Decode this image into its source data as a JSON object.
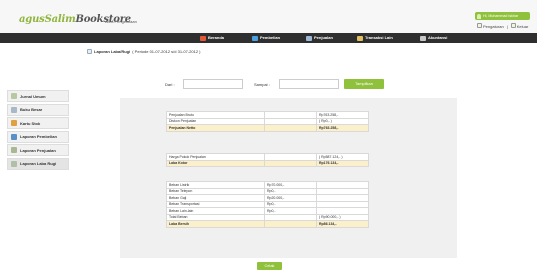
{
  "header": {
    "logo_main": "agusSalim",
    "logo_store": "Bookstore",
    "logo_sub": "Area Pengelolaan",
    "user": "Hi, Muhammad Iskhar",
    "settings_label": "Pengaturan",
    "separator": "|",
    "logout_label": "Keluar"
  },
  "nav": {
    "items": [
      {
        "label": "Beranda",
        "icon": "home-icon",
        "color": "#e05a3a"
      },
      {
        "label": "Pembelian",
        "icon": "cart-icon",
        "color": "#4aa0e0"
      },
      {
        "label": "Penjualan",
        "icon": "invoice-icon",
        "color": "#9fb8d8"
      },
      {
        "label": "Transaksi Lain",
        "icon": "pencil-icon",
        "color": "#e0c060"
      },
      {
        "label": "Akuntansi",
        "icon": "user-icon",
        "color": "#c8c8c8"
      }
    ]
  },
  "breadcrumb": {
    "title": "Laporan Laba/Rugi",
    "period": "( Periode 01-07-2012 s/d 31-07-2012 )"
  },
  "sidebar": {
    "items": [
      {
        "label": "Jurnal Umum",
        "icon": "journal-icon",
        "color": "#b8c8a0"
      },
      {
        "label": "Buku Besar",
        "icon": "ledger-icon",
        "color": "#a8b8c8"
      },
      {
        "label": "Kartu Stok",
        "icon": "stock-icon",
        "color": "#e0a040"
      },
      {
        "label": "Laporan Pembelian",
        "icon": "purchase-report-icon",
        "color": "#5a90c8"
      },
      {
        "label": "Laporan Penjualan",
        "icon": "sales-report-icon",
        "color": "#a8b890"
      },
      {
        "label": "Laporan Laba Rugi",
        "icon": "profit-report-icon",
        "color": "#b0c0a8"
      }
    ]
  },
  "filter": {
    "from_label": "Dari :",
    "to_label": "Sampai :",
    "from_value": "",
    "to_value": "",
    "submit_label": "Tampilkan"
  },
  "report": {
    "group1": [
      {
        "label": "Penjualan Bruto",
        "mid": "",
        "value": "Rp763.258,-",
        "highlight": false
      },
      {
        "label": "Diskon Penjualan",
        "mid": "",
        "value": "( Rp0,- )",
        "highlight": false
      },
      {
        "label": "Penjualan Netto",
        "mid": "",
        "value": "Rp763.258,-",
        "highlight": true
      }
    ],
    "group2": [
      {
        "label": "Harga Pokok Penjualan",
        "mid": "",
        "value": "( Rp587.124,- )",
        "highlight": false
      },
      {
        "label": "Laba Kotor",
        "mid": "",
        "value": "Rp176.134,-",
        "highlight": true
      }
    ],
    "group3": [
      {
        "label": "Beban Listrik",
        "mid": "Rp70.000,-",
        "value": "",
        "highlight": false
      },
      {
        "label": "Beban Telepon",
        "mid": "Rp0,-",
        "value": "",
        "highlight": false
      },
      {
        "label": "Beban Gaji",
        "mid": "Rp20.000,-",
        "value": "",
        "highlight": false
      },
      {
        "label": "Beban Transportasi",
        "mid": "Rp0,-",
        "value": "",
        "highlight": false
      },
      {
        "label": "Beban Lain-lain",
        "mid": "Rp0,-",
        "value": "",
        "highlight": false
      },
      {
        "label": "Total Beban",
        "mid": "",
        "value": "( Rp90.000,- )",
        "highlight": false
      },
      {
        "label": "Laba Bersih",
        "mid": "",
        "value": "Rp86.134,-",
        "highlight": true
      }
    ],
    "print_label": "Cetak"
  }
}
